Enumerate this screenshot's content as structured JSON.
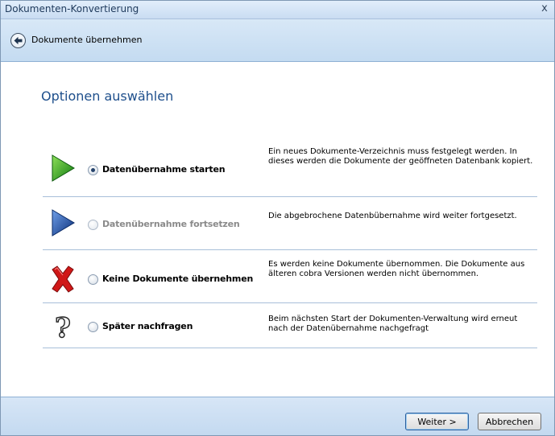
{
  "window": {
    "title": "Dokumenten-Konvertierung",
    "close_label": "x"
  },
  "nav": {
    "title": "Dokumente übernehmen",
    "back_icon": "back-arrow-icon"
  },
  "heading": "Optionen auswählen",
  "options": [
    {
      "icon": "play-green-icon",
      "label": "Datenübernahme starten",
      "selected": true,
      "enabled": true,
      "description": "Ein neues Dokumente-Verzeichnis muss festgelegt werden. In dieses werden die Dokumente der geöffneten Datenbank kopiert."
    },
    {
      "icon": "play-blue-icon",
      "label": "Datenübernahme fortsetzen",
      "selected": false,
      "enabled": false,
      "description": "Die abgebrochene Datenbübernahme wird weiter fortgesetzt."
    },
    {
      "icon": "red-x-icon",
      "label": "Keine Dokumente übernehmen",
      "selected": false,
      "enabled": true,
      "description": "Es werden keine Dokumente übernommen. Die Dokumente aus älteren cobra Versionen werden nicht übernommen."
    },
    {
      "icon": "question-mark-icon",
      "label": "Später nachfragen",
      "selected": false,
      "enabled": true,
      "description": "Beim nächsten Start der Dokumenten-Verwaltung wird erneut nach der Datenübernahme nachgefragt"
    }
  ],
  "buttons": {
    "next": "Weiter >",
    "cancel": "Abbrechen"
  },
  "colors": {
    "heading": "#1e4f8c",
    "nav_bg": "#c4dbf1",
    "separator": "#a8bfd9",
    "play_green": "#22a020",
    "play_blue": "#1b4fa8",
    "red_x": "#d01818"
  }
}
